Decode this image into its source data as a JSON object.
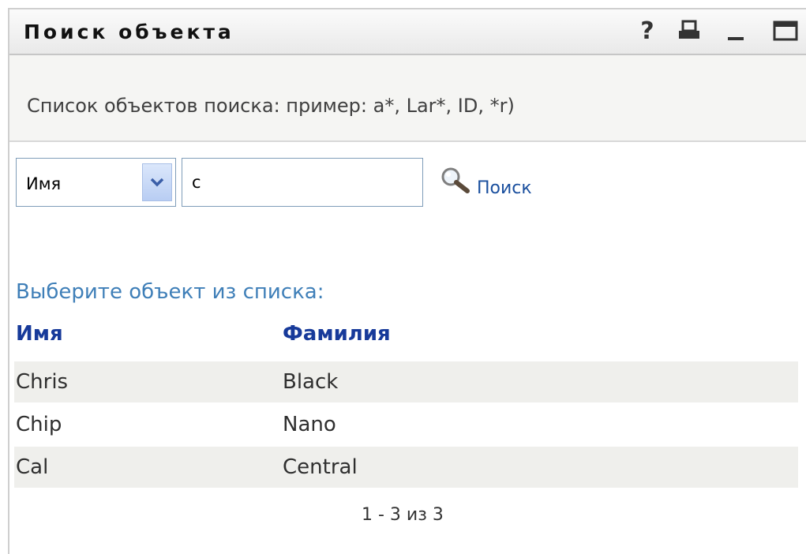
{
  "window": {
    "title": "Поиск объекта",
    "icons": [
      "help-icon",
      "print-icon",
      "minimize-icon",
      "maximize-icon"
    ],
    "help_glyph": "?"
  },
  "hint": {
    "text": "Список объектов поиска: пример: a*, Lar*, ID, *r)"
  },
  "search": {
    "field_select": "Имя",
    "query_value": "c",
    "button_label": "Поиск"
  },
  "results": {
    "prompt": "Выберите объект из списка:",
    "headers": [
      "Имя",
      "Фамилия"
    ],
    "rows": [
      [
        "Chris",
        "Black"
      ],
      [
        "Chip",
        "Nano"
      ],
      [
        "Cal",
        "Central"
      ]
    ],
    "pager": "1 - 3 из 3"
  },
  "colors": {
    "link": "#1a4f9e",
    "header_link": "#173a9a",
    "prompt": "#3f7fb8",
    "alt_row": "#efefec"
  }
}
